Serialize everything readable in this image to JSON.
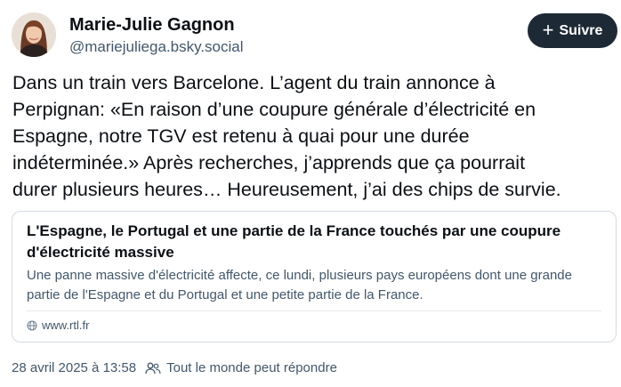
{
  "author": {
    "name": "Marie-Julie Gagnon",
    "handle": "@mariejuliega.bsky.social",
    "avatar_icon": "profile-photo"
  },
  "follow_button": {
    "label": "Suivre",
    "icon": "plus-icon"
  },
  "post": {
    "lines": [
      "Dans un train vers Barcelone. L’agent du train annonce à",
      "Perpignan: «En raison d’une coupure générale d’électricité en",
      "Espagne, notre TGV est retenu à quai pour une durée",
      "indéterminée.» Après recherches, j’apprends que ça pourrait",
      "durer plusieurs heures… Heureusement, j’ai des chips de survie."
    ]
  },
  "link_card": {
    "title": "L'Espagne, le Portugal et une partie de la France touchés par une coupure d'électricité massive",
    "description": "Une panne massive d'électricité affecte, ce lundi, plusieurs pays européens dont une grande partie de l'Espagne et du Portugal et une petite partie de la France.",
    "domain": "www.rtl.fr",
    "domain_icon": "globe-icon"
  },
  "footer": {
    "timestamp": "28 avril 2025 à 13:58",
    "reply_setting": "Tout le monde peut répondre",
    "reply_icon": "people-icon"
  },
  "colors": {
    "text": "#0b0f14",
    "secondary": "#42576c",
    "button_bg": "#1e2936",
    "border": "#d4dbe2"
  }
}
